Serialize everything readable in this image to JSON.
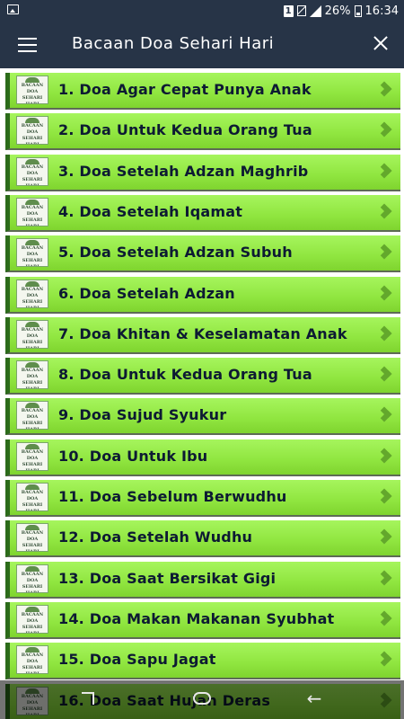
{
  "status_bar": {
    "sim_slot": "1",
    "battery_percent": "26%",
    "time": "16:34"
  },
  "app_bar": {
    "title": "Bacaan Doa Sehari Hari"
  },
  "list": {
    "items": [
      {
        "label": "1. Doa Agar Cepat Punya Anak"
      },
      {
        "label": "2. Doa Untuk Kedua Orang Tua"
      },
      {
        "label": "3. Doa Setelah Adzan Maghrib"
      },
      {
        "label": "4. Doa Setelah Iqamat"
      },
      {
        "label": "5. Doa Setelah Adzan Subuh"
      },
      {
        "label": "6. Doa Setelah Adzan"
      },
      {
        "label": "7. Doa Khitan & Keselamatan Anak"
      },
      {
        "label": "8. Doa Untuk Kedua Orang Tua"
      },
      {
        "label": "9. Doa Sujud Syukur"
      },
      {
        "label": "10. Doa Untuk Ibu"
      },
      {
        "label": "11. Doa Sebelum Berwudhu"
      },
      {
        "label": "12. Doa Setelah Wudhu"
      },
      {
        "label": "13. Doa Saat Bersikat Gigi"
      },
      {
        "label": "14. Doa Makan Makanan Syubhat"
      },
      {
        "label": "15. Doa Sapu Jagat"
      },
      {
        "label": "16. Doa Saat Hujan Deras"
      }
    ]
  },
  "logo": {
    "line1": "BACAAN",
    "line2": "DOA",
    "line3": "SEHARI HARI"
  },
  "colors": {
    "bar": "#273447",
    "item_green": "#8fe53f",
    "item_border": "#2c6b1a",
    "chevron": "#63a82c"
  }
}
